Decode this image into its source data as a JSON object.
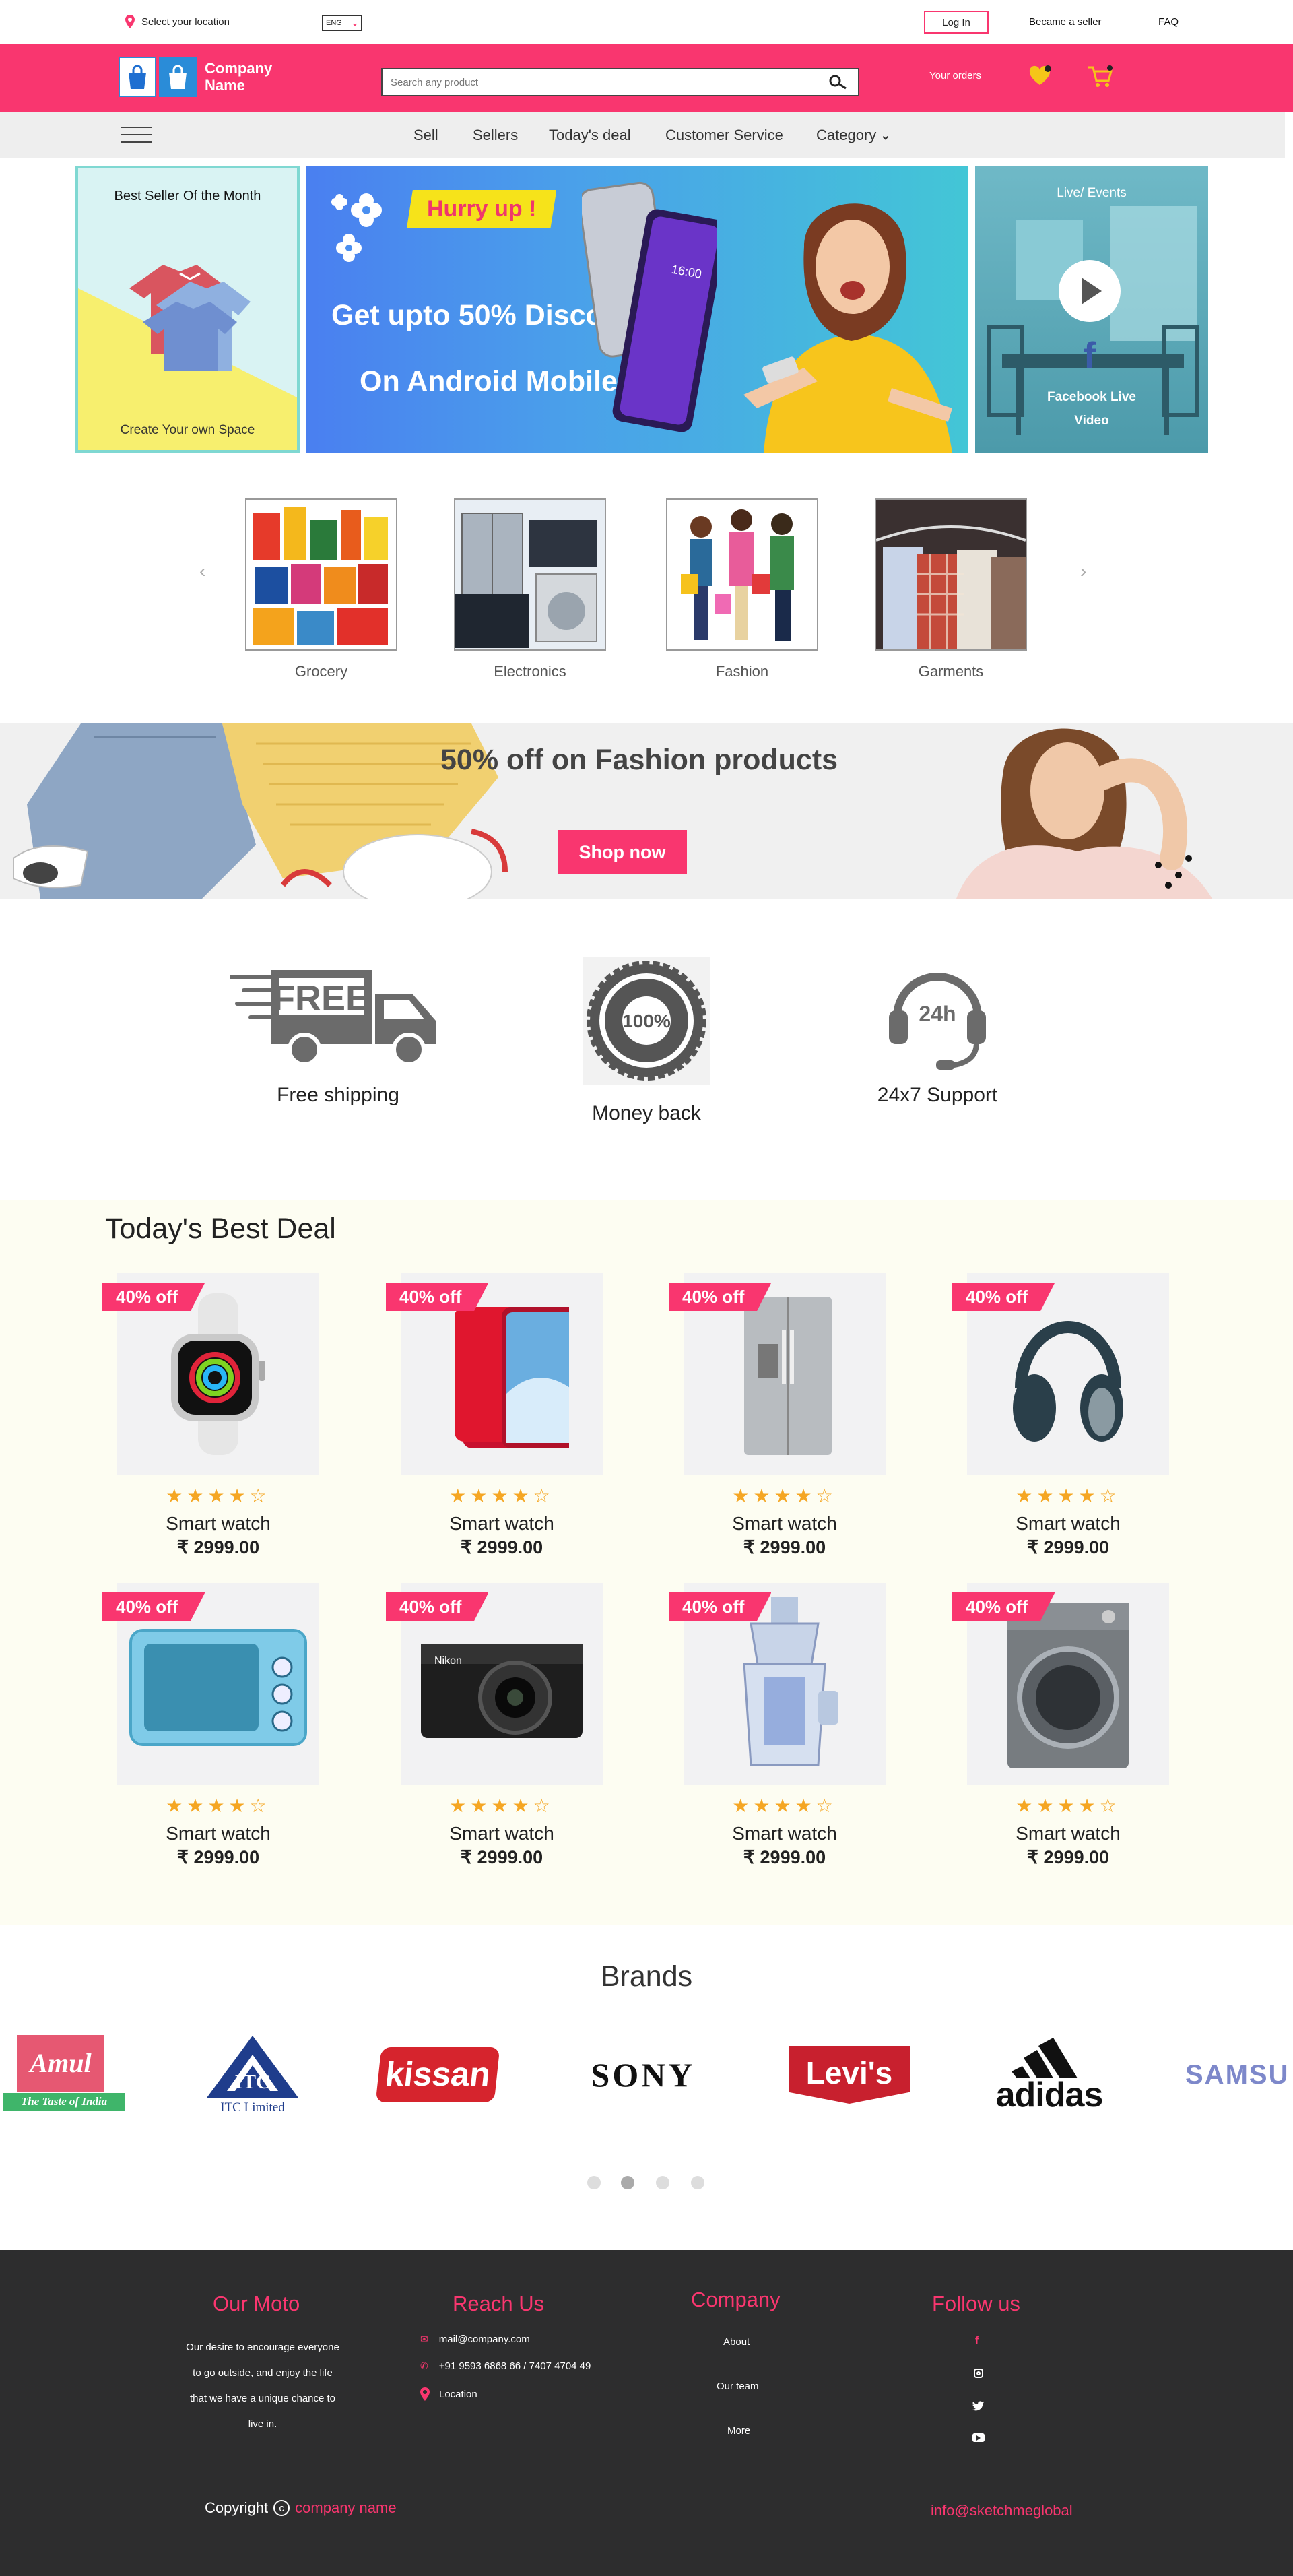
{
  "topbar": {
    "location_label": "Select your location",
    "language": "ENG",
    "login_label": "Log In",
    "seller_label": "Became a seller",
    "faq_label": "FAQ"
  },
  "header": {
    "logo_line1": "Company",
    "logo_line2": "Name",
    "search_placeholder": "Search any product",
    "orders_label": "Your orders"
  },
  "nav": {
    "menu_icon": "hamburger-icon",
    "items": [
      "Sell",
      "Sellers",
      "Today's deal",
      "Customer Service",
      "Category"
    ]
  },
  "promos": {
    "best_seller_title": "Best Seller Of the Month",
    "best_seller_caption": "Create Your own Space",
    "banner_tag": "Hurry up !",
    "banner_line1": "Get upto 50% Discount",
    "banner_line2": "On Android Mobile",
    "live_title": "Live/ Events",
    "live_caption_line1": "Facebook Live",
    "live_caption_line2": "Video"
  },
  "categories": [
    "Grocery",
    "Electronics",
    "Fashion",
    "Garments"
  ],
  "fashion_banner": {
    "headline": "50% off on Fashion products",
    "cta": "Shop now"
  },
  "features": {
    "free_badge": "FREE",
    "guarantee_text": "100%",
    "support_text": "24h",
    "items": [
      "Free shipping",
      "Money back",
      "24x7 Support"
    ]
  },
  "deals": {
    "title": "Today's Best Deal",
    "badge": "40% off",
    "rating": 4,
    "products": [
      {
        "name": "Smart watch",
        "price": "₹ 2999.00",
        "image": "smartwatch"
      },
      {
        "name": "Smart watch",
        "price": "₹ 2999.00",
        "image": "phone"
      },
      {
        "name": "Smart watch",
        "price": "₹ 2999.00",
        "image": "fridge"
      },
      {
        "name": "Smart watch",
        "price": "₹ 2999.00",
        "image": "headphones"
      },
      {
        "name": "Smart watch",
        "price": "₹ 2999.00",
        "image": "microwave"
      },
      {
        "name": "Smart watch",
        "price": "₹ 2999.00",
        "image": "camera"
      },
      {
        "name": "Smart watch",
        "price": "₹ 2999.00",
        "image": "juicer"
      },
      {
        "name": "Smart watch",
        "price": "₹ 2999.00",
        "image": "washing-machine"
      }
    ]
  },
  "brands": {
    "title": "Brands",
    "amul": "Amul",
    "amul_tagline": "The Taste of India",
    "itc": "ITC Limited",
    "kissan": "kissan",
    "sony": "SONY",
    "levis": "Levi's",
    "adidas": "adidas",
    "samsung": "SAMSU"
  },
  "footer": {
    "moto_title": "Our Moto",
    "moto_lines": [
      "Our desire to encourage everyone",
      "to go outside, and enjoy the life",
      "that we have a unique chance to",
      "live in."
    ],
    "reach_title": "Reach Us",
    "email": "mail@company.com",
    "phone": "+91 9593 6868 66 / 7407 4704 49",
    "location": "Location",
    "company_title": "Company",
    "company_links": [
      "About",
      "Our team",
      "More"
    ],
    "follow_title": "Follow us",
    "copyright": "Copyright",
    "company_name": "company name",
    "contact_email": "info@sketchmeglobal"
  },
  "colors": {
    "accent": "#f9366f",
    "footer": "#2d2d2e",
    "star": "#f5a623"
  }
}
